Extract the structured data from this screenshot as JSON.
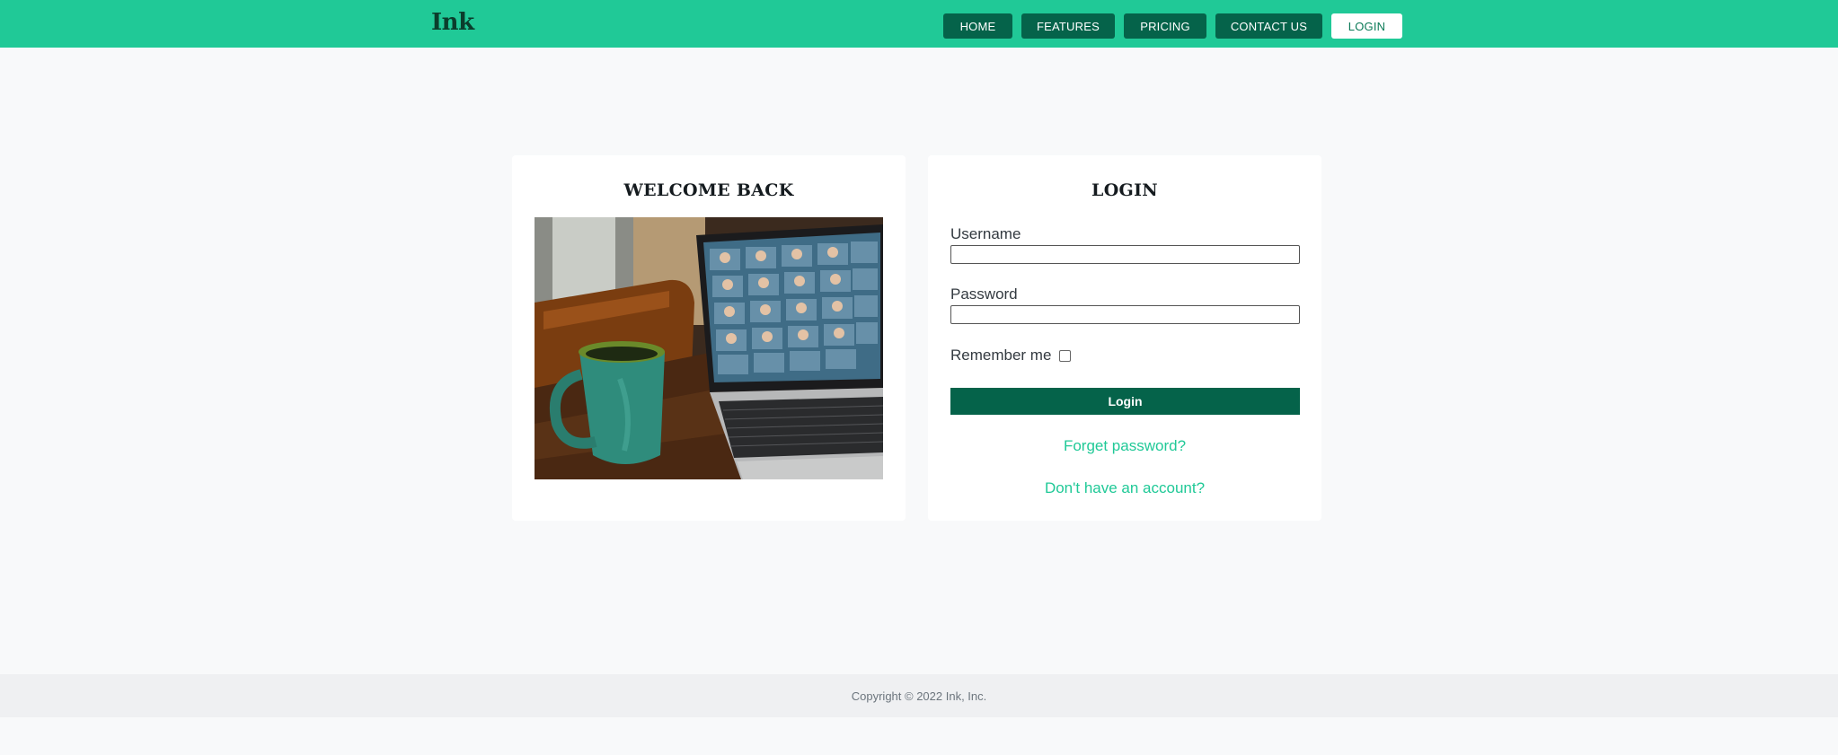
{
  "header": {
    "brand": "Ink",
    "nav": [
      {
        "label": "HOME"
      },
      {
        "label": "FEATURES"
      },
      {
        "label": "PRICING"
      },
      {
        "label": "CONTACT US"
      },
      {
        "label": "LOGIN"
      }
    ]
  },
  "welcome": {
    "title": "WELCOME BACK",
    "image_icon": "laptop-video-call-photo"
  },
  "login": {
    "title": "LOGIN",
    "username_label": "Username",
    "username_value": "",
    "password_label": "Password",
    "password_value": "",
    "remember_label": "Remember me",
    "remember_checked": false,
    "submit_label": "Login",
    "forgot_link": "Forget password?",
    "signup_link": "Don't have an account?"
  },
  "footer": {
    "copyright": "Copyright © 2022 Ink, Inc."
  },
  "colors": {
    "header_bg": "#20c997",
    "button_dark": "#05634a",
    "link": "#20c997"
  }
}
